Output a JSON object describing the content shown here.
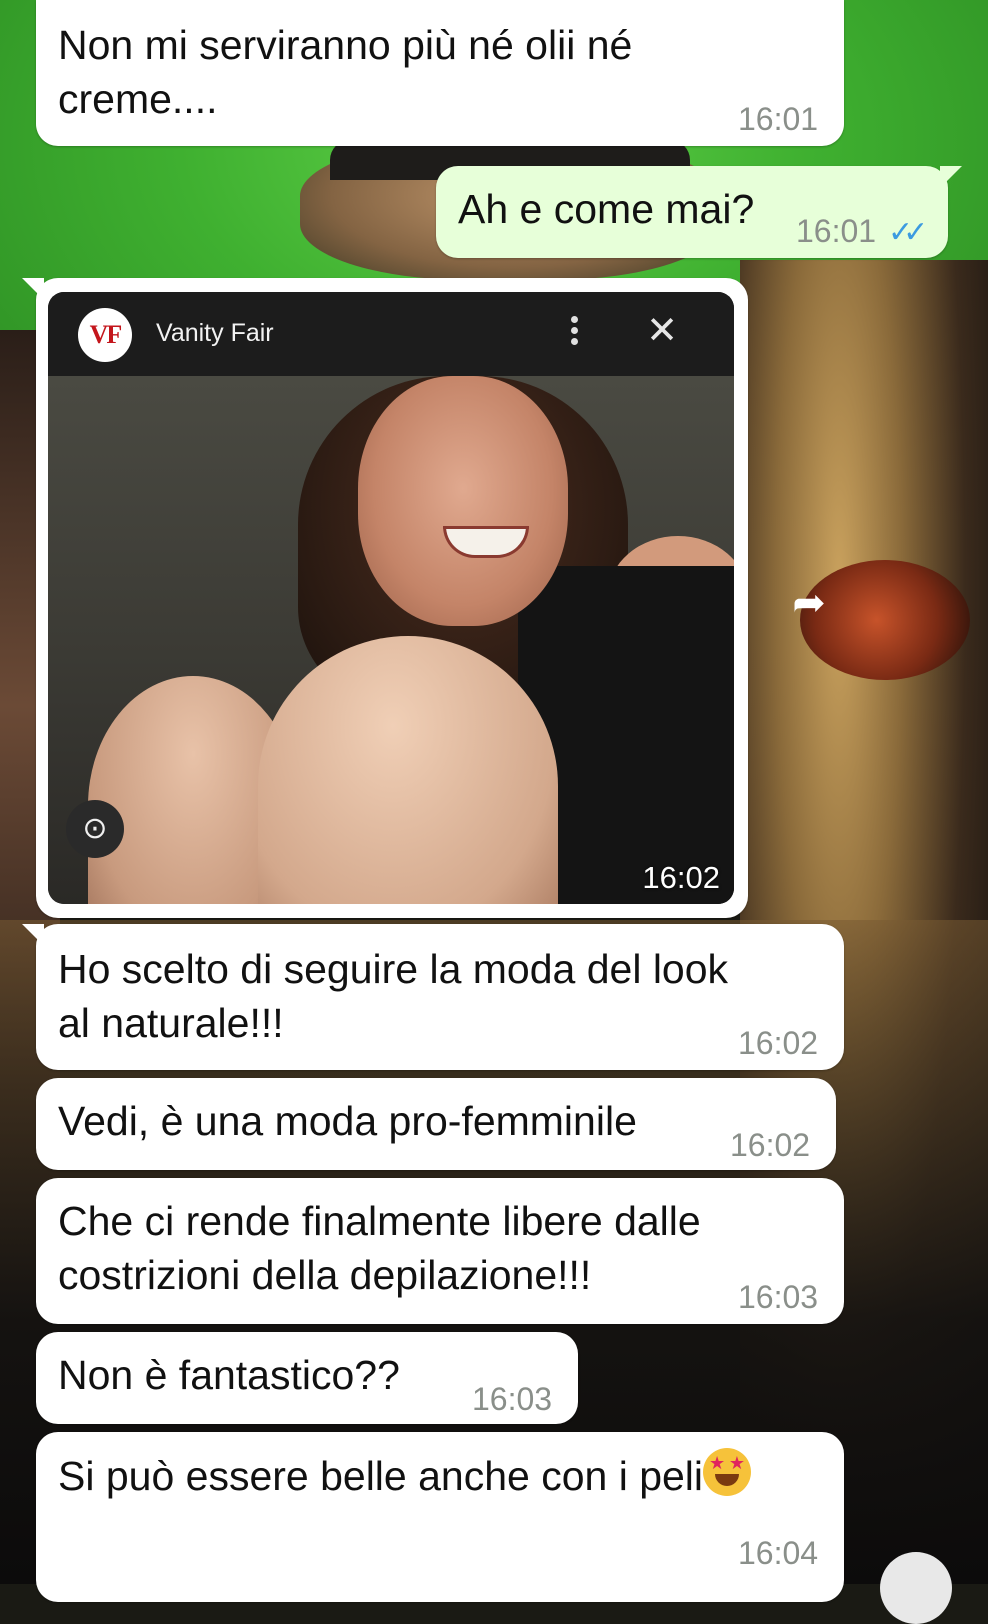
{
  "messages": [
    {
      "text_line1": "Non mi serviranno più né olii né",
      "text_line2": "creme....",
      "time": "16:01",
      "direction": "in"
    },
    {
      "text": "Ah e come mai?",
      "time": "16:01",
      "status": "read",
      "direction": "out"
    },
    {
      "text_line1": "Ho scelto di seguire la moda del look",
      "text_line2": "al naturale!!!",
      "time": "16:02",
      "direction": "in"
    },
    {
      "text": "Vedi, è una moda pro-femminile",
      "time": "16:02",
      "direction": "in"
    },
    {
      "text_line1": "Che ci rende finalmente libere dalle",
      "text_line2": "costrizioni della depilazione!!!",
      "time": "16:03",
      "direction": "in"
    },
    {
      "text": "Non è fantastico??",
      "time": "16:03",
      "direction": "in"
    },
    {
      "text": "Si può essere belle anche con i peli",
      "time": "16:04",
      "direction": "in",
      "emoji": "star-struck"
    }
  ],
  "image_card": {
    "source_logo": "VF",
    "source_name": "Vanity Fair",
    "time": "16:02"
  },
  "colors": {
    "incoming_bubble": "#ffffff",
    "outgoing_bubble": "#e7ffd9",
    "read_ticks": "#3c9be0",
    "timestamp": "#8a8f8a"
  },
  "icons": {
    "read_receipt": "double-check-icon",
    "menu": "more-vert-icon",
    "close": "close-icon",
    "lens": "lens-icon",
    "forward": "forward-icon"
  }
}
